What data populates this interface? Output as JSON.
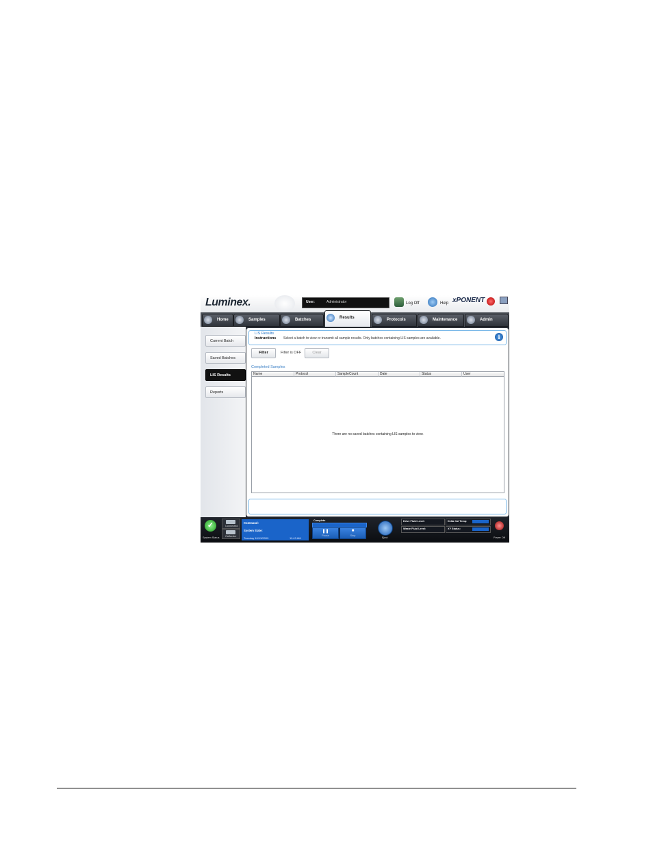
{
  "header": {
    "logo": "Luminex.",
    "user_label": "User:",
    "user_value": "Administrator",
    "log_off": "Log Off",
    "help": "Help",
    "brand": "xPONENT"
  },
  "nav": {
    "tabs": [
      {
        "label": "Home"
      },
      {
        "label": "Samples"
      },
      {
        "label": "Batches"
      },
      {
        "label": "Results",
        "active": true
      },
      {
        "label": "Protocols"
      },
      {
        "label": "Maintenance"
      },
      {
        "label": "Admin"
      }
    ]
  },
  "sidebar": {
    "items": [
      {
        "label": "Current Batch"
      },
      {
        "label": "Saved Batches"
      },
      {
        "label": "LIS Results",
        "active": true
      },
      {
        "label": "Reports"
      }
    ]
  },
  "main": {
    "section_title": "LIS Results",
    "instructions_label": "Instructions",
    "instructions_text": "Select a batch to view or transmit all sample results. Only batches containing LIS samples are available.",
    "info_glyph": "i",
    "filter_button": "Filter",
    "filter_state": "Filter is OFF",
    "clear_button": "Clear",
    "table_title": "Completed Samples",
    "columns": [
      "Name",
      "Protocol",
      "SampleCount",
      "Date",
      "Status",
      "User"
    ],
    "empty_message": "There are no saved batches containing LIS samples to view."
  },
  "statusbar": {
    "system_status": "System Status",
    "connected": "Connected",
    "cal_label": "Calfeeder",
    "command_label": "Command:",
    "system_state_label": "System State:",
    "date": "Tuesday 10/13/2009",
    "time": "11:43 AM",
    "progress_label": "Complete",
    "pause_label": "Pause",
    "stop_label": "Stop",
    "eject_label": "Eject",
    "sheath_label": "Drive Fluid Level:",
    "waste_label": "Waste Fluid Level:",
    "delta_label": "Delta Cal Temp:",
    "xy_label": "XY Status:",
    "power_label": "Power Off",
    "colors": {
      "accent": "#1a64c9",
      "ok": "#1f9a1f"
    }
  }
}
